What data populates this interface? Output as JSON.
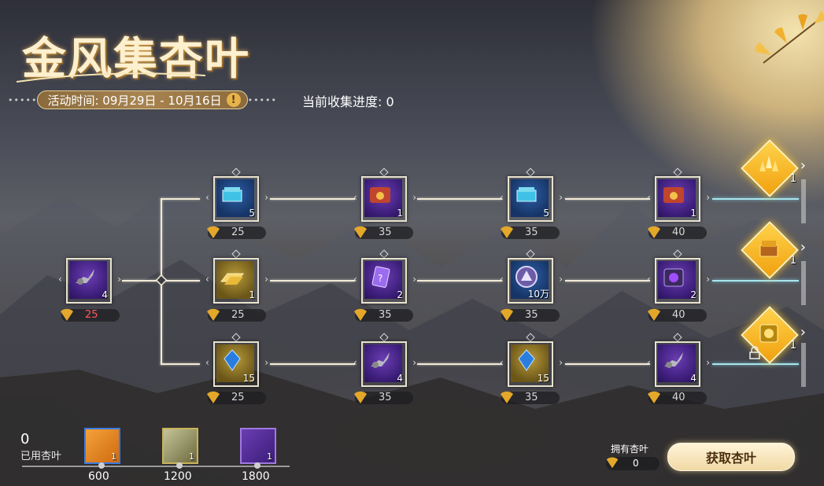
{
  "title": "金风集杏叶",
  "activity": {
    "label": "活动时间: 09月29日 - 10月16日",
    "warn_glyph": "!"
  },
  "progress": {
    "label": "当前收集进度: 0"
  },
  "start_node": {
    "qty": "4",
    "cost": "25"
  },
  "rows": [
    {
      "nodes": [
        {
          "qty": "5",
          "cost": "25"
        },
        {
          "qty": "1",
          "cost": "35"
        },
        {
          "qty": "5",
          "cost": "35"
        },
        {
          "qty": "1",
          "cost": "40"
        }
      ]
    },
    {
      "nodes": [
        {
          "qty": "1",
          "cost": "25"
        },
        {
          "qty": "2",
          "cost": "35"
        },
        {
          "qty": "10万",
          "cost": "35"
        },
        {
          "qty": "2",
          "cost": "40"
        }
      ]
    },
    {
      "nodes": [
        {
          "qty": "15",
          "cost": "25"
        },
        {
          "qty": "4",
          "cost": "35"
        },
        {
          "qty": "15",
          "cost": "35"
        },
        {
          "qty": "4",
          "cost": "40"
        }
      ]
    }
  ],
  "final_rewards": [
    {
      "qty": "1"
    },
    {
      "qty": "1"
    },
    {
      "qty": "1"
    }
  ],
  "used": {
    "value": "0",
    "label": "已用杏叶"
  },
  "milestones": [
    {
      "qty": "1",
      "threshold": "600"
    },
    {
      "qty": "1",
      "threshold": "1200"
    },
    {
      "qty": "1",
      "threshold": "1800"
    }
  ],
  "owned": {
    "label": "拥有杏叶",
    "value": "0"
  },
  "get_button": {
    "label": "获取杏叶"
  },
  "colors": {
    "leaf": "#e3a72a",
    "line": "#f2ead6",
    "cyan_line": "#a7e6ec",
    "accent_gold": "#f1a10f"
  }
}
